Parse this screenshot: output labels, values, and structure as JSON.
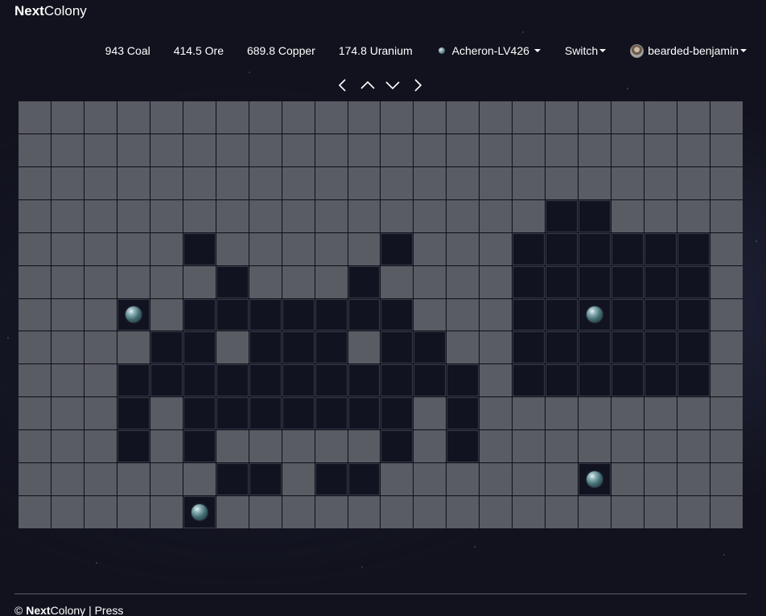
{
  "brand": {
    "bold": "Next",
    "rest": "Colony"
  },
  "resources": [
    {
      "label": "943 Coal"
    },
    {
      "label": "414.5 Ore"
    },
    {
      "label": "689.8 Copper"
    },
    {
      "label": "174.8 Uranium"
    }
  ],
  "planet_select": {
    "label": "Acheron-LV426"
  },
  "switch": {
    "label": "Switch"
  },
  "user": {
    "name": "bearded-benjamin"
  },
  "map": {
    "cols": 22,
    "rows": 13,
    "dark_cells": [
      [
        3,
        16
      ],
      [
        3,
        17
      ],
      [
        4,
        5
      ],
      [
        4,
        11
      ],
      [
        4,
        15
      ],
      [
        4,
        16
      ],
      [
        4,
        17
      ],
      [
        4,
        18
      ],
      [
        4,
        19
      ],
      [
        4,
        20
      ],
      [
        5,
        6
      ],
      [
        5,
        10
      ],
      [
        5,
        15
      ],
      [
        5,
        16
      ],
      [
        5,
        17
      ],
      [
        5,
        18
      ],
      [
        5,
        19
      ],
      [
        5,
        20
      ],
      [
        6,
        3
      ],
      [
        6,
        5
      ],
      [
        6,
        6
      ],
      [
        6,
        7
      ],
      [
        6,
        8
      ],
      [
        6,
        9
      ],
      [
        6,
        10
      ],
      [
        6,
        11
      ],
      [
        6,
        15
      ],
      [
        6,
        16
      ],
      [
        6,
        17
      ],
      [
        6,
        18
      ],
      [
        6,
        19
      ],
      [
        6,
        20
      ],
      [
        7,
        4
      ],
      [
        7,
        5
      ],
      [
        7,
        7
      ],
      [
        7,
        8
      ],
      [
        7,
        9
      ],
      [
        7,
        11
      ],
      [
        7,
        12
      ],
      [
        7,
        15
      ],
      [
        7,
        16
      ],
      [
        7,
        17
      ],
      [
        7,
        18
      ],
      [
        7,
        19
      ],
      [
        7,
        20
      ],
      [
        8,
        3
      ],
      [
        8,
        4
      ],
      [
        8,
        5
      ],
      [
        8,
        6
      ],
      [
        8,
        7
      ],
      [
        8,
        8
      ],
      [
        8,
        9
      ],
      [
        8,
        10
      ],
      [
        8,
        11
      ],
      [
        8,
        12
      ],
      [
        8,
        13
      ],
      [
        8,
        15
      ],
      [
        8,
        16
      ],
      [
        8,
        17
      ],
      [
        8,
        18
      ],
      [
        8,
        19
      ],
      [
        8,
        20
      ],
      [
        9,
        3
      ],
      [
        9,
        5
      ],
      [
        9,
        6
      ],
      [
        9,
        7
      ],
      [
        9,
        8
      ],
      [
        9,
        9
      ],
      [
        9,
        10
      ],
      [
        9,
        11
      ],
      [
        9,
        13
      ],
      [
        10,
        3
      ],
      [
        10,
        5
      ],
      [
        10,
        11
      ],
      [
        10,
        13
      ],
      [
        11,
        6
      ],
      [
        11,
        7
      ],
      [
        11,
        9
      ],
      [
        11,
        10
      ],
      [
        11,
        17
      ],
      [
        12,
        5
      ]
    ],
    "planets": [
      {
        "row": 6,
        "col": 3,
        "icon": "planet-icon"
      },
      {
        "row": 6,
        "col": 17,
        "icon": "planet-icon"
      },
      {
        "row": 11,
        "col": 17,
        "icon": "planet-icon"
      },
      {
        "row": 12,
        "col": 5,
        "icon": "planet-icon"
      }
    ]
  },
  "footer": {
    "copyright": "©",
    "bold": "Next",
    "rest": "Colony",
    "separator": "|",
    "press": "Press"
  }
}
